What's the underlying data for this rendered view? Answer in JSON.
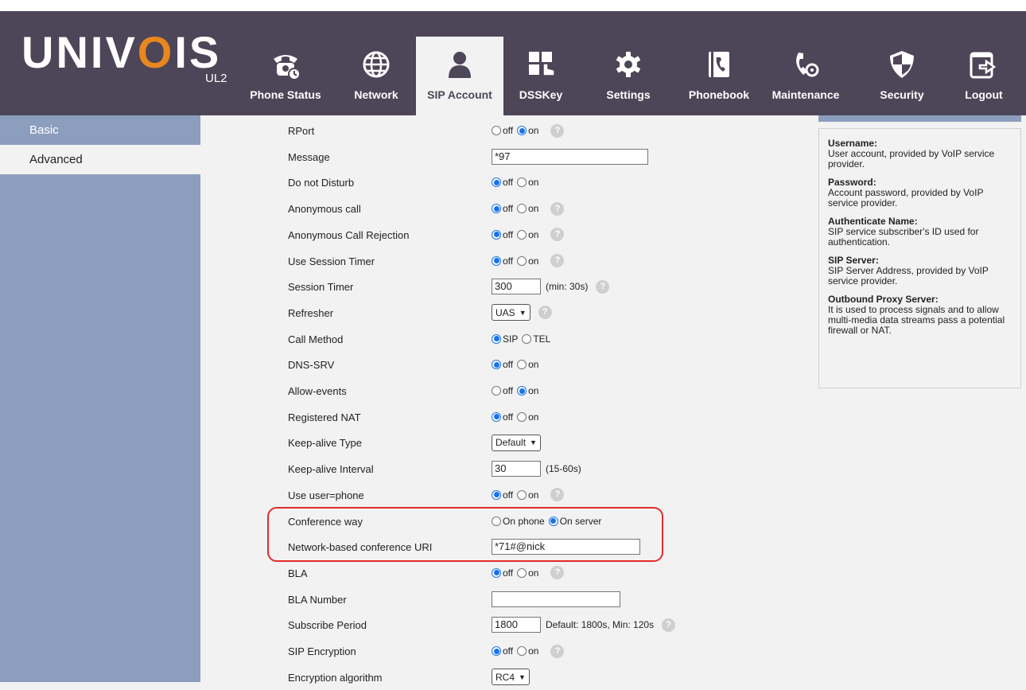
{
  "brand": {
    "logo_left": "UNIV",
    "logo_o": "O",
    "logo_right": "IS",
    "model": "UL2"
  },
  "nav": [
    {
      "label": "Phone Status",
      "icon": "phone-status-icon",
      "active": false
    },
    {
      "label": "Network",
      "icon": "globe-icon",
      "active": false
    },
    {
      "label": "SIP Account",
      "icon": "user-icon",
      "active": true
    },
    {
      "label": "DSSKey",
      "icon": "dsskey-icon",
      "active": false
    },
    {
      "label": "Settings",
      "icon": "gear-icon",
      "active": false
    },
    {
      "label": "Phonebook",
      "icon": "phonebook-icon",
      "active": false
    },
    {
      "label": "Maintenance",
      "icon": "maintenance-icon",
      "active": false
    },
    {
      "label": "Security",
      "icon": "shield-icon",
      "active": false
    },
    {
      "label": "Logout",
      "icon": "logout-icon",
      "active": false
    }
  ],
  "sidebar": {
    "items": [
      {
        "label": "Basic",
        "active": false
      },
      {
        "label": "Advanced",
        "active": true
      }
    ]
  },
  "form": {
    "rows": [
      {
        "label": "RPort",
        "type": "radio",
        "options": [
          "off",
          "on"
        ],
        "selected": 1,
        "help": true
      },
      {
        "label": "Message",
        "type": "text",
        "value": "*97",
        "width": 197
      },
      {
        "label": "Do not Disturb",
        "type": "radio",
        "options": [
          "off",
          "on"
        ],
        "selected": 0,
        "help": false
      },
      {
        "label": "Anonymous call",
        "type": "radio",
        "options": [
          "off",
          "on"
        ],
        "selected": 0,
        "help": true
      },
      {
        "label": "Anonymous Call Rejection",
        "type": "radio",
        "options": [
          "off",
          "on"
        ],
        "selected": 0,
        "help": true
      },
      {
        "label": "Use Session Timer",
        "type": "radio",
        "options": [
          "off",
          "on"
        ],
        "selected": 0,
        "help": true
      },
      {
        "label": "Session Timer",
        "type": "text",
        "value": "300",
        "width": 62,
        "unit": "(min: 30s)",
        "help": true
      },
      {
        "label": "Refresher",
        "type": "select",
        "value": "UAS",
        "help": true
      },
      {
        "label": "Call Method",
        "type": "radio",
        "options": [
          "SIP",
          "TEL"
        ],
        "selected": 0,
        "help": false
      },
      {
        "label": "DNS-SRV",
        "type": "radio",
        "options": [
          "off",
          "on"
        ],
        "selected": 0,
        "help": false
      },
      {
        "label": "Allow-events",
        "type": "radio",
        "options": [
          "off",
          "on"
        ],
        "selected": 1,
        "help": false
      },
      {
        "label": "Registered NAT",
        "type": "radio",
        "options": [
          "off",
          "on"
        ],
        "selected": 0,
        "help": false
      },
      {
        "label": "Keep-alive Type",
        "type": "select",
        "value": "Default"
      },
      {
        "label": "Keep-alive Interval",
        "type": "text",
        "value": "30",
        "width": 62,
        "unit": "(15-60s)"
      },
      {
        "label": "Use user=phone",
        "type": "radio",
        "options": [
          "off",
          "on"
        ],
        "selected": 0,
        "help": true
      },
      {
        "label": "Conference way",
        "type": "radio",
        "options": [
          "On phone",
          "On server"
        ],
        "selected": 1,
        "help": false
      },
      {
        "label": "Network-based conference URI",
        "type": "text",
        "value": "*71#@nick",
        "width": 187
      },
      {
        "label": "BLA",
        "type": "radio",
        "options": [
          "off",
          "on"
        ],
        "selected": 0,
        "help": true
      },
      {
        "label": "BLA Number",
        "type": "text",
        "value": "",
        "width": 162
      },
      {
        "label": "Subscribe Period",
        "type": "text",
        "value": "1800",
        "width": 62,
        "unit": "Default: 1800s, Min: 120s",
        "help": true
      },
      {
        "label": "SIP Encryption",
        "type": "radio",
        "options": [
          "off",
          "on"
        ],
        "selected": 0,
        "help": true
      },
      {
        "label": "Encryption algorithm",
        "type": "select",
        "value": "RC4"
      }
    ]
  },
  "help_panel": {
    "entries": [
      {
        "title": "Username:",
        "text": "User account, provided by VoIP service provider."
      },
      {
        "title": "Password:",
        "text": "Account password, provided by VoIP service provider."
      },
      {
        "title": "Authenticate Name:",
        "text": "SIP service subscriber's ID used for authentication."
      },
      {
        "title": "SIP Server:",
        "text": "SIP Server Address, provided by VoIP service provider."
      },
      {
        "title": "Outbound Proxy Server:",
        "text": "It is used to process signals and to allow multi-media data streams pass a potential firewall or NAT."
      }
    ]
  },
  "colors": {
    "header": "#4d4558",
    "sidebar": "#8c9ebd",
    "accent": "#e8871e",
    "highlight": "#e32b2b",
    "radio": "#1a73e8"
  }
}
